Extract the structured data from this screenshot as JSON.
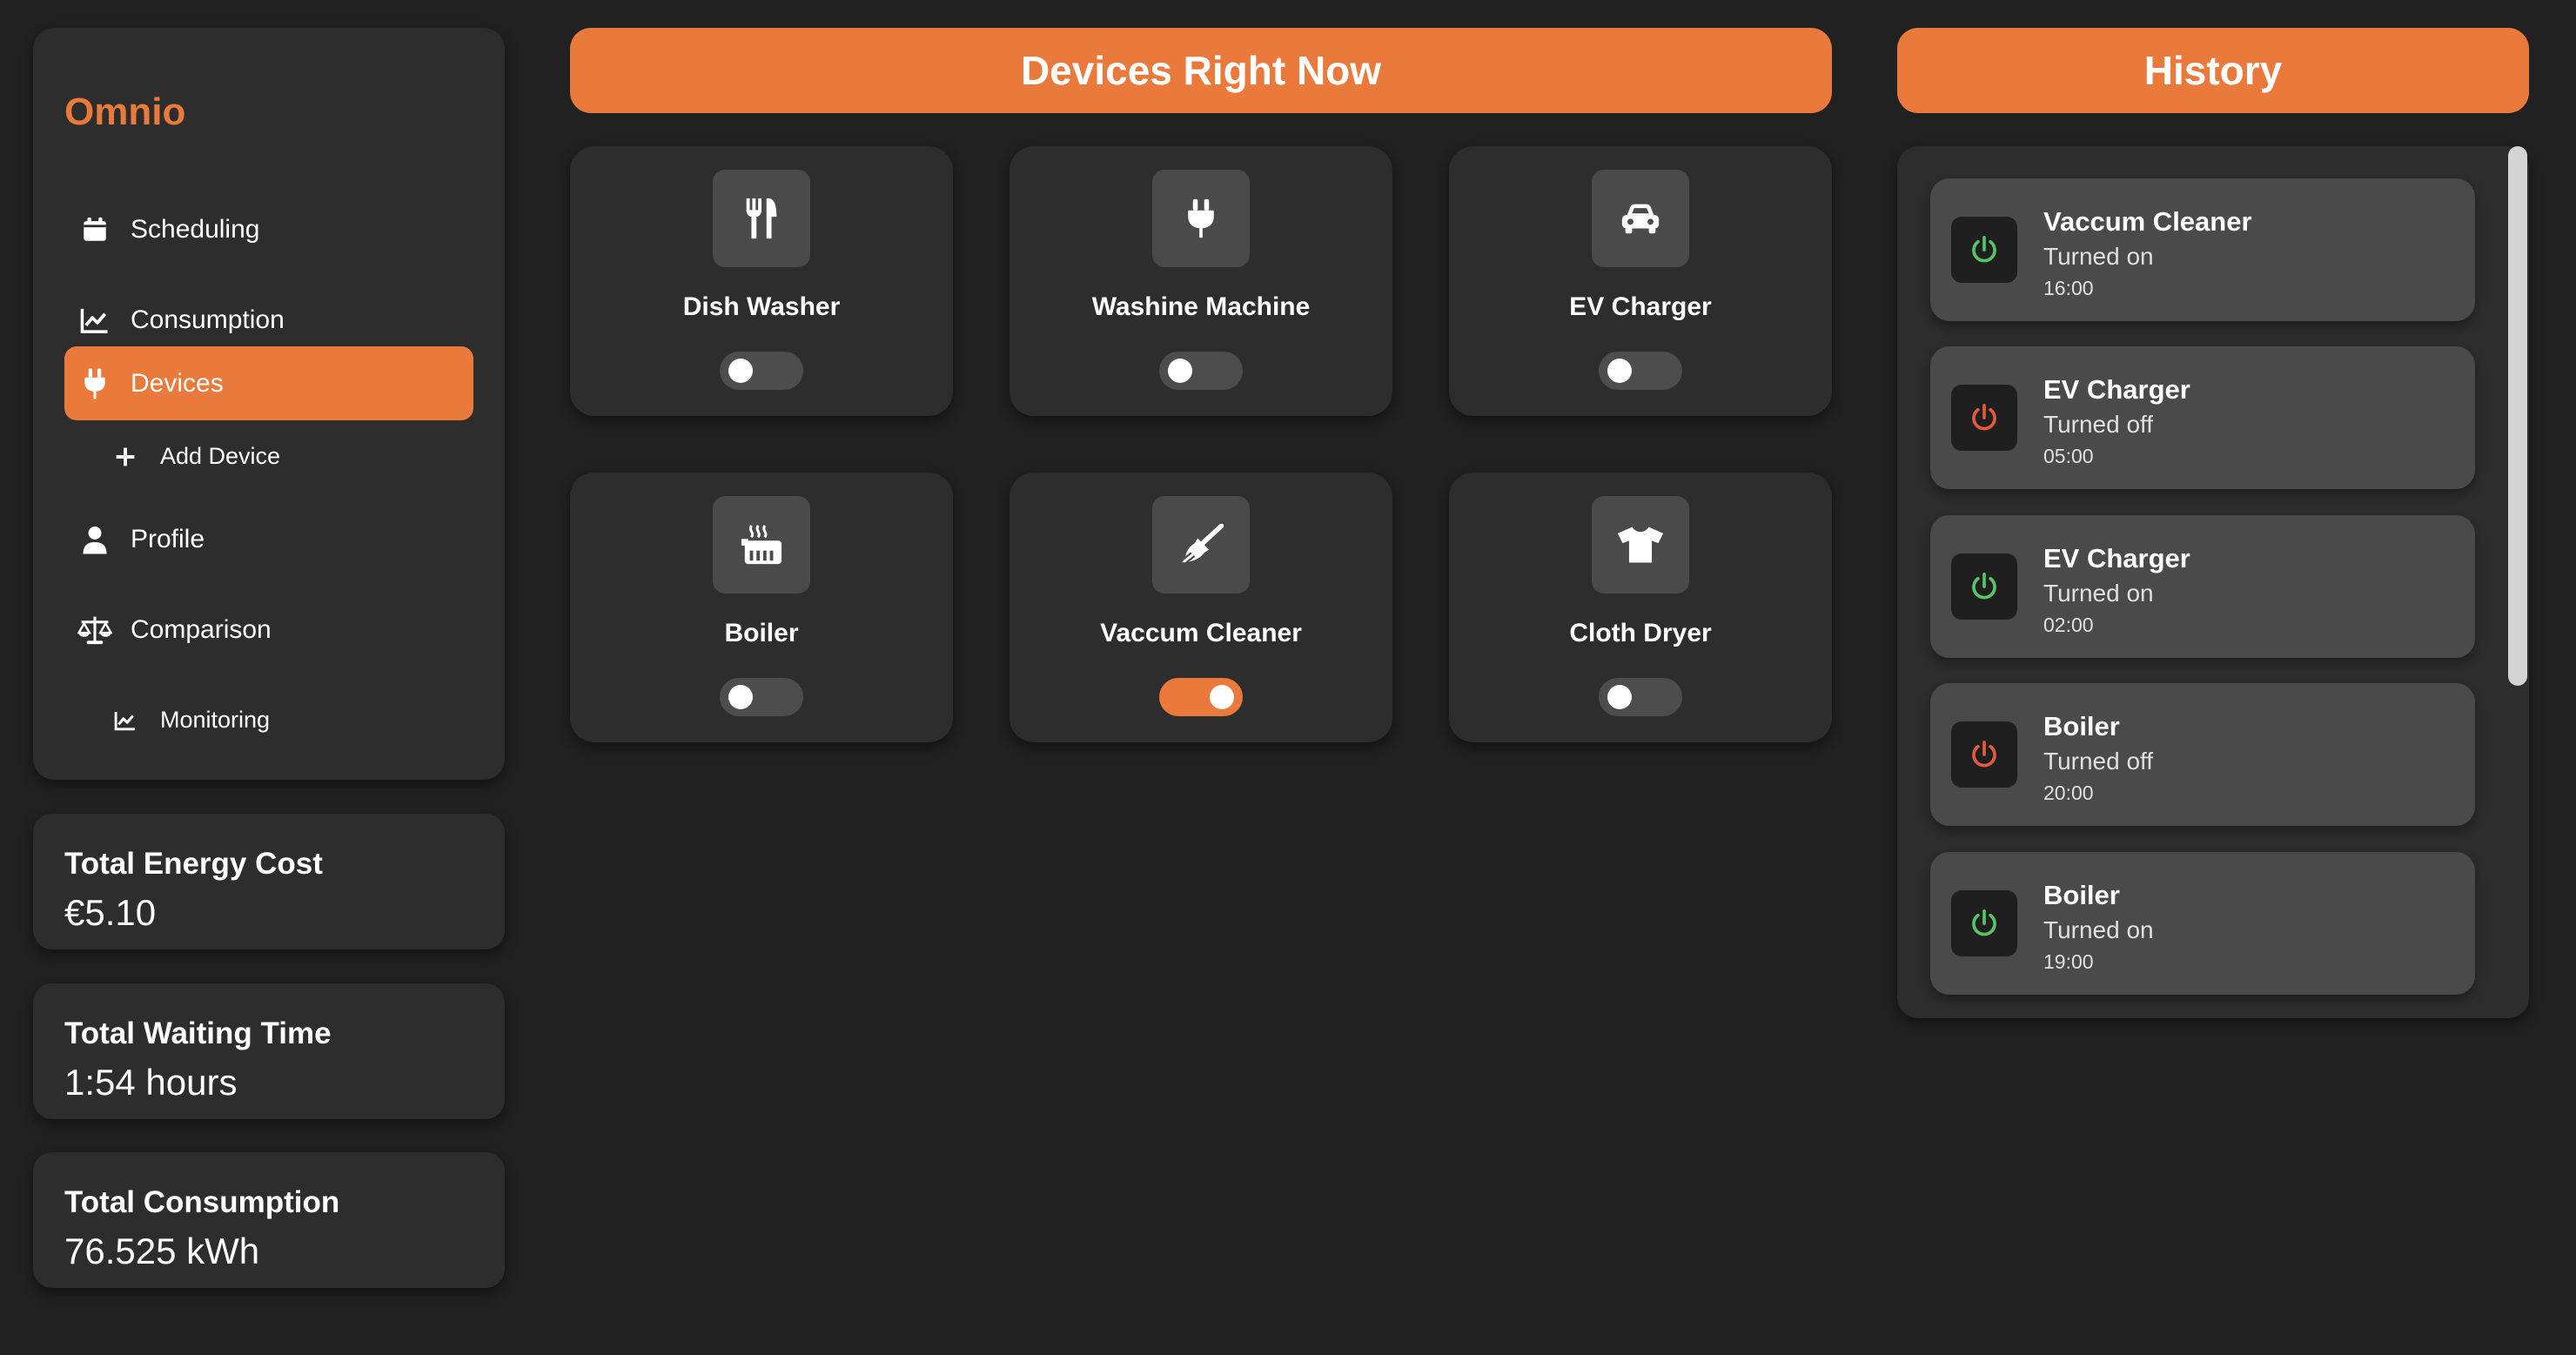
{
  "app": {
    "name": "Omnio"
  },
  "colors": {
    "accent": "#ea7a3c",
    "on": "#57c469",
    "off": "#e35a3d"
  },
  "nav": {
    "scheduling": "Scheduling",
    "consumption": "Consumption",
    "devices": "Devices",
    "add_device": "Add Device",
    "profile": "Profile",
    "comparison": "Comparison",
    "monitoring": "Monitoring"
  },
  "stats": [
    {
      "title": "Total Energy Cost",
      "value": "€5.10"
    },
    {
      "title": "Total Waiting Time",
      "value": "1:54 hours"
    },
    {
      "title": "Total Consumption",
      "value": "76.525 kWh"
    }
  ],
  "devices_panel": {
    "title": "Devices Right Now",
    "devices": [
      {
        "name": "Dish Washer",
        "icon": "utensils-icon",
        "on": false
      },
      {
        "name": "Washine Machine",
        "icon": "plug-icon",
        "on": false
      },
      {
        "name": "EV Charger",
        "icon": "car-icon",
        "on": false
      },
      {
        "name": "Boiler",
        "icon": "boiler-icon",
        "on": false
      },
      {
        "name": "Vaccum Cleaner",
        "icon": "broom-icon",
        "on": true
      },
      {
        "name": "Cloth Dryer",
        "icon": "shirt-icon",
        "on": false
      }
    ]
  },
  "history": {
    "title": "History",
    "items": [
      {
        "device": "Vaccum Cleaner",
        "status": "Turned on",
        "time": "16:00",
        "icon": "power-icon"
      },
      {
        "device": "EV Charger",
        "status": "Turned off",
        "time": "05:00",
        "icon": "power-icon"
      },
      {
        "device": "EV Charger",
        "status": "Turned on",
        "time": "02:00",
        "icon": "power-icon"
      },
      {
        "device": "Boiler",
        "status": "Turned off",
        "time": "20:00",
        "icon": "power-icon"
      },
      {
        "device": "Boiler",
        "status": "Turned on",
        "time": "19:00",
        "icon": "power-icon"
      }
    ]
  }
}
